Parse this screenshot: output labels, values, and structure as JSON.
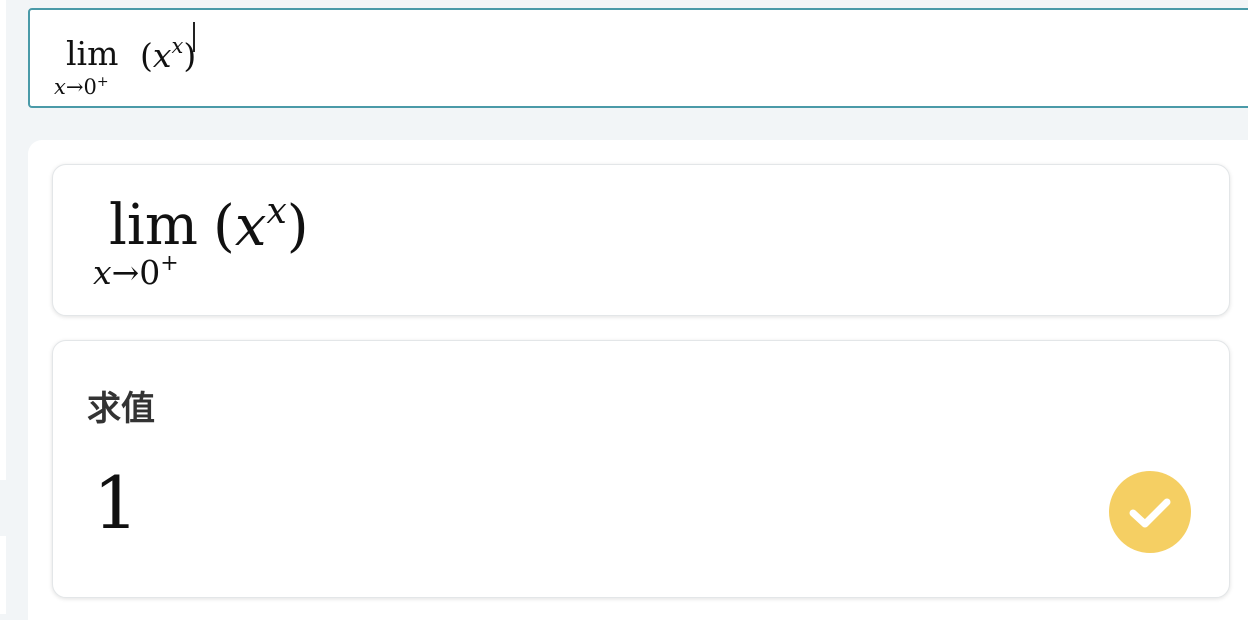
{
  "input": {
    "lim": "lim",
    "subscript_var": "x",
    "subscript_arrow": "→",
    "subscript_target": "0",
    "subscript_sign": "+",
    "open_paren": "(",
    "base": "x",
    "exponent": "x",
    "close_paren": ")"
  },
  "expression_card": {
    "lim": "lim",
    "subscript_var": "x",
    "subscript_arrow": "→",
    "subscript_target": "0",
    "subscript_sign": "+",
    "open_paren": "(",
    "base": "x",
    "exponent": "x",
    "close_paren": ")"
  },
  "result_card": {
    "title": "求值",
    "value": "1",
    "status_icon": "check-icon"
  },
  "colors": {
    "input_border": "#4a9aa8",
    "page_background": "#f2f5f7",
    "check_badge": "#f5cf63"
  }
}
